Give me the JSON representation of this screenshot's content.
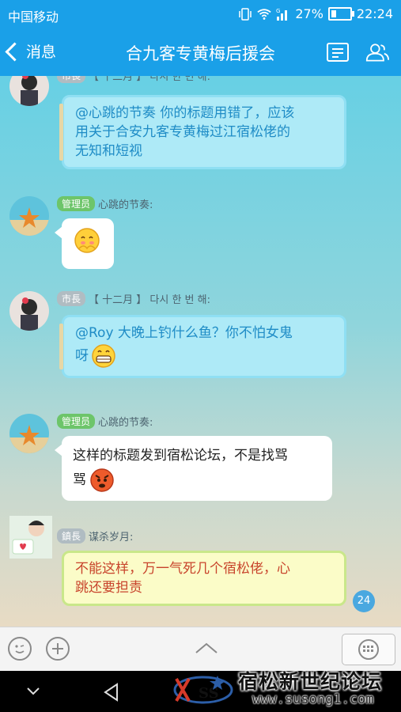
{
  "status_bar": {
    "carrier": "中国移动",
    "battery": "27%",
    "time": "22:24"
  },
  "header": {
    "back_label": "消息",
    "title": "合九客专黄梅后援会"
  },
  "messages": [
    {
      "badge": "市長",
      "sender": "【 十二月 】 다시 한 번 해:",
      "text_lines": [
        "@心跳的节奏 你的标题用错了，应该",
        "用关于合安九客专黄梅过江宿松佬的",
        "无知和短视"
      ]
    },
    {
      "badge": "管理员",
      "sender": "心跳的节奏:"
    },
    {
      "badge": "市長",
      "sender": "【 十二月 】 다시 한 번 해:",
      "text_lines": [
        "@Roy 大晚上钓什么鱼？你不怕女鬼",
        "呀"
      ]
    },
    {
      "badge": "管理员",
      "sender": "心跳的节奏:",
      "text_lines": [
        "这样的标题发到宿松论坛，不是找骂",
        "骂"
      ]
    },
    {
      "badge": "鎮長",
      "sender": "谋杀岁月:",
      "text_lines": [
        "不能这样，万一气死几个宿松佬，心",
        "跳还要担责"
      ]
    }
  ],
  "unread_count": "24",
  "watermark": {
    "logo_text": "SS",
    "title": "宿松新世纪论坛",
    "url": "www.susong1.com"
  },
  "colors": {
    "header_bg": "#1aa0e8",
    "badge_green": "#6dc56a",
    "badge_gray": "#b0bcc2",
    "blue_bubble": "#aeeaf7",
    "yellow_bubble": "#fbfcc8"
  },
  "icons": [
    "signal-icon",
    "wifi-icon",
    "battery-icon",
    "back-chevron-icon",
    "group-notice-icon",
    "group-members-icon",
    "emoji-icon",
    "plus-icon",
    "expand-up-icon",
    "keyboard-icon",
    "nav-back-icon",
    "nav-home-icon",
    "nav-recent-icon"
  ]
}
